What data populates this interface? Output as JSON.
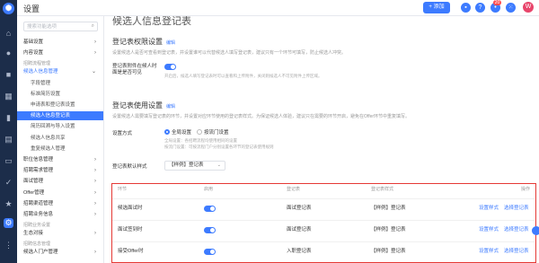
{
  "app": {
    "title": "设置",
    "add_label": "+ 添加",
    "notif_count": "20",
    "avatar": "W"
  },
  "sidebar": {
    "search_placeholder": "搜索功能选项",
    "items": [
      {
        "label": "基础设置",
        "kind": "top",
        "arrow": "›"
      },
      {
        "label": "内容设置",
        "kind": "top",
        "arrow": "›"
      },
      {
        "label": "招聘流程管理",
        "kind": "group"
      },
      {
        "label": "候选人信息管理",
        "kind": "open",
        "arrow": "⌄"
      },
      {
        "label": "字段管理",
        "kind": "sub"
      },
      {
        "label": "标准简历设置",
        "kind": "sub"
      },
      {
        "label": "申请表和登记表设置",
        "kind": "sub"
      },
      {
        "label": "候选人信息登记表",
        "kind": "active"
      },
      {
        "label": "简历回溯与导入设置",
        "kind": "sub"
      },
      {
        "label": "候选人信息共享",
        "kind": "sub"
      },
      {
        "label": "重复候选人管理",
        "kind": "sub"
      },
      {
        "label": "职位信息管理",
        "kind": "top",
        "arrow": "›"
      },
      {
        "label": "招聘需求管理",
        "kind": "top",
        "arrow": "›"
      },
      {
        "label": "面试管理",
        "kind": "top",
        "arrow": "›"
      },
      {
        "label": "Offer管理",
        "kind": "top",
        "arrow": "›"
      },
      {
        "label": "招聘渠道管理",
        "kind": "top",
        "arrow": "›"
      },
      {
        "label": "招聘业务信息",
        "kind": "top",
        "arrow": "›"
      },
      {
        "label": "招聘业务设置",
        "kind": "group"
      },
      {
        "label": "生态对接",
        "kind": "top",
        "arrow": "›"
      },
      {
        "label": "招聘信息管理",
        "kind": "group"
      },
      {
        "label": "候选人门户管理",
        "kind": "top",
        "arrow": "›"
      }
    ]
  },
  "main": {
    "page_title": "候选人信息登记表",
    "perm": {
      "title": "登记表权限设置",
      "edit": "编辑",
      "desc": "设置候选人是否可查看到登记表，并设置谁可以代替候选人填写登记表，建议只有一个环节可填写，防止候选人冲突。",
      "toggle_label": "登记表附件在候人时\n面是是否可见",
      "hint": "开启后，候选人填写登记表时可以查看和上传附件，关闭则候选人不可见附件上传区域。"
    },
    "usage": {
      "title": "登记表使用设置",
      "edit": "编辑",
      "desc": "设置候选人需要填写登记表的环节，并设置对应环节使用的登记表样式。为保证候选人体验，建议只在需要的环节开启，避免在Offer环节中重复填写。",
      "mode_label": "设置方式",
      "mode_all": "全局设置",
      "mode_flow": "按流门设置",
      "hint1": "全局设置：各招聘流程均使用相同的设置",
      "hint2": "按流门设置：可按流程门户分别设置各环节的登记表使用规则",
      "style_label": "登记表默认样式",
      "style_value": "【样例】登记表"
    },
    "table": {
      "headers": [
        "环节",
        "启用",
        "登记表",
        "登记表样式",
        "操作"
      ],
      "rows": [
        {
          "stage": "候选面试时",
          "table_name": "面试登记表",
          "style": "【样例】登记表",
          "act1": "设置样式",
          "act2": "选择登记表"
        },
        {
          "stage": "面试签到时",
          "table_name": "面试登记表",
          "style": "【样例】登记表",
          "act1": "设置样式",
          "act2": "选择登记表"
        },
        {
          "stage": "接受Offer时",
          "table_name": "入职登记表",
          "style": "【样例】登记表",
          "act1": "设置样式",
          "act2": "选择登记表"
        }
      ]
    }
  }
}
